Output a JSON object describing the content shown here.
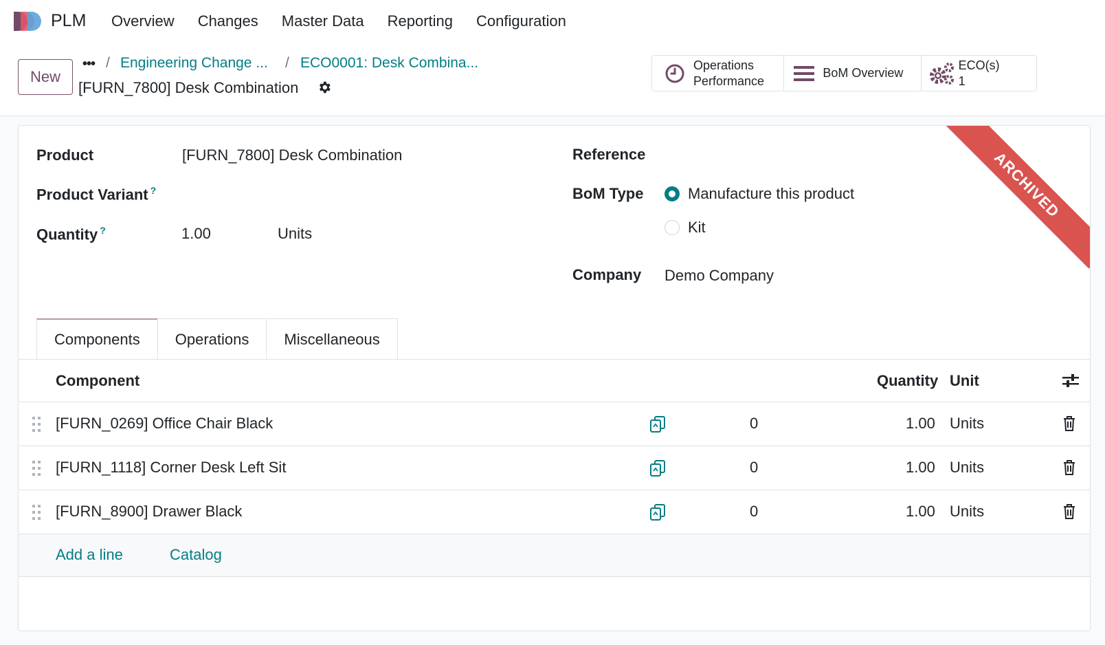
{
  "nav": {
    "app_name": "PLM",
    "menu": [
      "Overview",
      "Changes",
      "Master Data",
      "Reporting",
      "Configuration"
    ]
  },
  "control": {
    "new_label": "New",
    "breadcrumb_dots": "•••",
    "breadcrumb": [
      "Engineering Change ...",
      "ECO0001: Desk Combina..."
    ],
    "record_title": "[FURN_7800] Desk Combination"
  },
  "stats": {
    "operations_line1": "Operations",
    "operations_line2": "Performance",
    "bom_overview": "BoM Overview",
    "eco_label": "ECO(s)",
    "eco_count": "1"
  },
  "ribbon": "ARCHIVED",
  "form": {
    "product_label": "Product",
    "product_value": "[FURN_7800] Desk Combination",
    "variant_label": "Product Variant",
    "quantity_label": "Quantity",
    "quantity_value": "1.00",
    "quantity_unit": "Units",
    "help_mark": "?",
    "reference_label": "Reference",
    "bom_type_label": "BoM Type",
    "bom_type_options": [
      "Manufacture this product",
      "Kit"
    ],
    "bom_type_selected": "Manufacture this product",
    "company_label": "Company",
    "company_value": "Demo Company"
  },
  "tabs": [
    "Components",
    "Operations",
    "Miscellaneous"
  ],
  "table": {
    "headers": {
      "component": "Component",
      "quantity": "Quantity",
      "unit": "Unit"
    },
    "rows": [
      {
        "component": "[FURN_0269] Office Chair Black",
        "count": "0",
        "quantity": "1.00",
        "unit": "Units"
      },
      {
        "component": "[FURN_1118] Corner Desk Left Sit",
        "count": "0",
        "quantity": "1.00",
        "unit": "Units"
      },
      {
        "component": "[FURN_8900] Drawer Black",
        "count": "0",
        "quantity": "1.00",
        "unit": "Units"
      }
    ],
    "add_line": "Add a line",
    "catalog": "Catalog"
  },
  "colors": {
    "brand": "#714B67",
    "link": "#017e84",
    "ribbon": "#d9534f"
  }
}
